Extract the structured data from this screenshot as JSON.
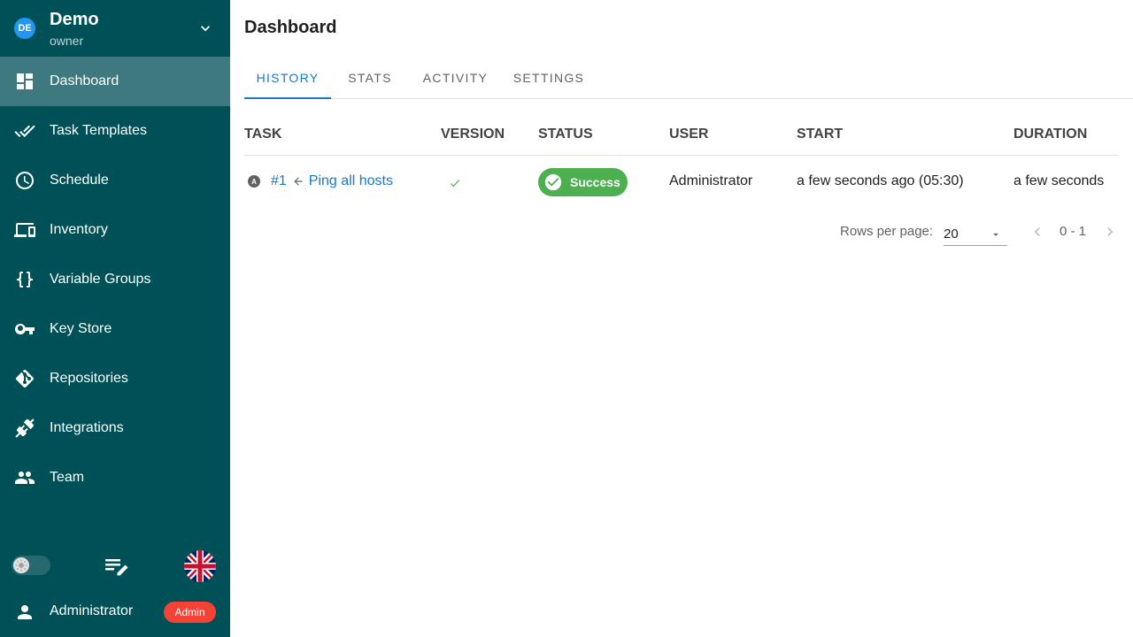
{
  "project": {
    "avatar_text": "DE",
    "name": "Demo",
    "role": "owner"
  },
  "nav": {
    "items": [
      {
        "label": "Dashboard",
        "icon": "dashboard-icon",
        "active": true
      },
      {
        "label": "Task Templates",
        "icon": "double-check-icon",
        "active": false
      },
      {
        "label": "Schedule",
        "icon": "clock-icon",
        "active": false
      },
      {
        "label": "Inventory",
        "icon": "monitor-icon",
        "active": false
      },
      {
        "label": "Variable Groups",
        "icon": "braces-icon",
        "active": false
      },
      {
        "label": "Key Store",
        "icon": "key-icon",
        "active": false
      },
      {
        "label": "Repositories",
        "icon": "git-icon",
        "active": false
      },
      {
        "label": "Integrations",
        "icon": "plug-icon",
        "active": false
      },
      {
        "label": "Team",
        "icon": "team-icon",
        "active": false
      }
    ]
  },
  "footer": {
    "user_name": "Administrator",
    "admin_badge": "Admin"
  },
  "page": {
    "title": "Dashboard"
  },
  "tabs": [
    {
      "label": "HISTORY",
      "active": true
    },
    {
      "label": "STATS",
      "active": false
    },
    {
      "label": "ACTIVITY",
      "active": false
    },
    {
      "label": "SETTINGS",
      "active": false
    }
  ],
  "table": {
    "headers": {
      "task": "TASK",
      "version": "VERSION",
      "status": "STATUS",
      "user": "USER",
      "start": "START",
      "duration": "DURATION"
    },
    "rows": [
      {
        "task_id": "#1",
        "task_name": "Ping all hosts",
        "app_icon": "ansible-icon",
        "app_icon_text": "A",
        "version_icon": "check-icon",
        "status": "Success",
        "user": "Administrator",
        "start": "a few seconds ago (05:30)",
        "duration": "a few seconds"
      }
    ]
  },
  "pagination": {
    "rows_per_page_label": "Rows per page:",
    "rows_per_page": "20",
    "range": "0 - 1"
  },
  "colors": {
    "sidebar": "#005057",
    "accent": "#1976d2",
    "success": "#4caf50",
    "admin_badge": "#f44336",
    "project_avatar": "#2196f3"
  }
}
